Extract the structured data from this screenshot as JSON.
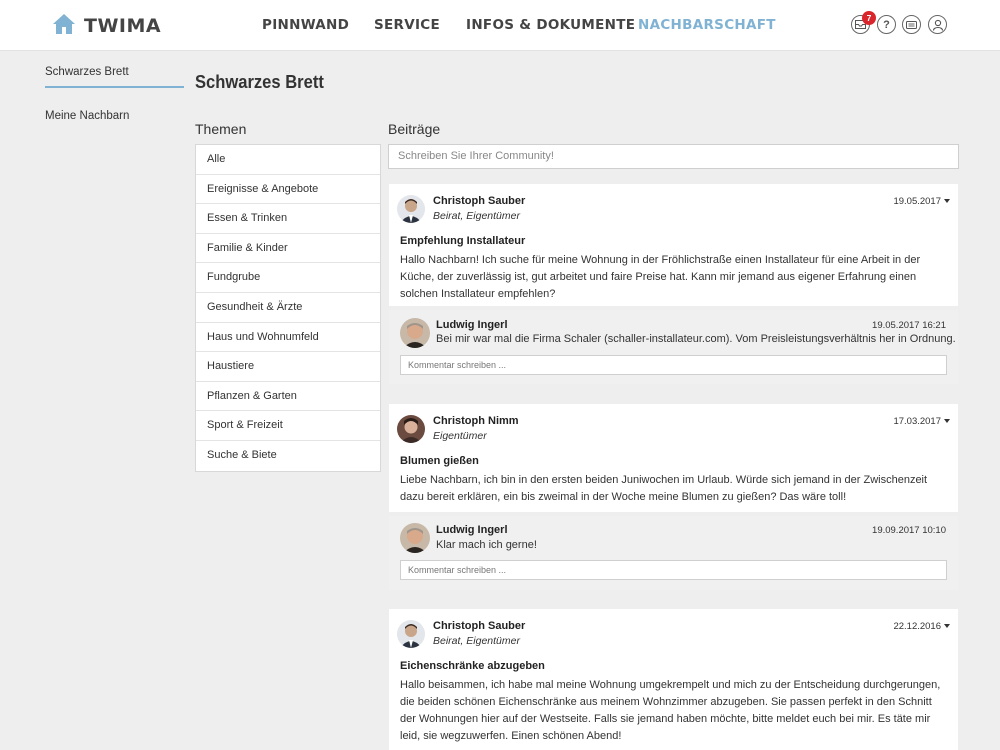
{
  "header": {
    "brand": "TWIMA",
    "nav": [
      "PINNWAND",
      "SERVICE",
      "INFOS & DOKUMENTE",
      "NACHBARSCHAFT"
    ],
    "active_nav": "NACHBARSCHAFT",
    "notification_count": "7",
    "help_icon_glyph": "?",
    "icons": [
      "home-icon",
      "inbox-icon",
      "help-icon",
      "chat-icon",
      "user-icon"
    ]
  },
  "sidebar": {
    "items": [
      "Schwarzes Brett",
      "Meine Nachbarn"
    ],
    "active": "Schwarzes Brett"
  },
  "page_title": "Schwarzes Brett",
  "topics": {
    "title": "Themen",
    "items": [
      "Alle",
      "Ereignisse & Angebote",
      "Essen & Trinken",
      "Familie & Kinder",
      "Fundgrube",
      "Gesundheit & Ärzte",
      "Haus und Wohnumfeld",
      "Haustiere",
      "Pflanzen & Garten",
      "Sport & Freizeit",
      "Suche & Biete"
    ]
  },
  "feed": {
    "title": "Beiträge",
    "compose_placeholder": "Schreiben Sie Ihrer Community!",
    "comment_placeholder": "Kommentar schreiben ...",
    "posts": [
      {
        "author": "Christoph Sauber",
        "role": "Beirat, Eigentümer",
        "date": "19.05.2017",
        "title": "Empfehlung Installateur",
        "text": "Hallo Nachbarn! Ich suche für meine Wohnung in der Fröhlichstraße einen Installateur für eine Arbeit in der Küche, der zuverlässig ist, gut arbeitet und faire Preise hat. Kann mir jemand aus eigener Erfahrung einen solchen Installateur empfehlen?",
        "comment": {
          "author": "Ludwig Ingerl",
          "date": "19.05.2017 16:21",
          "text": "Bei mir war mal die Firma Schaler (schaller-installateur.com). Vom Preisleistungsverhältnis her in Ordnung."
        }
      },
      {
        "author": "Christoph Nimm",
        "role": "Eigentümer",
        "date": "17.03.2017",
        "title": "Blumen gießen",
        "text": "Liebe Nachbarn, ich bin in den ersten beiden Juniwochen im Urlaub. Würde sich jemand in der Zwischenzeit dazu bereit erklären, ein bis zweimal in der Woche meine Blumen zu gießen? Das wäre toll!",
        "comment": {
          "author": "Ludwig Ingerl",
          "date": "19.09.2017 10:10",
          "text": "Klar mach ich gerne!"
        }
      },
      {
        "author": "Christoph Sauber",
        "role": "Beirat, Eigentümer",
        "date": "22.12.2016",
        "title": "Eichenschränke abzugeben",
        "text": "Hallo beisammen, ich habe mal meine Wohnung umgekrempelt und mich zu der Entscheidung durchgerungen, die beiden schönen Eichenschränke aus meinem Wohnzimmer abzugeben. Sie passen perfekt in den Schnitt der Wohnungen hier auf der Westseite. Falls sie jemand haben möchte, bitte meldet euch bei mir. Es täte mir leid, sie wegzuwerfen. Einen schönen Abend!"
      }
    ]
  },
  "colors": {
    "accent": "#7fb2d3",
    "badge": "#d9262c",
    "background": "#eeeeee"
  }
}
